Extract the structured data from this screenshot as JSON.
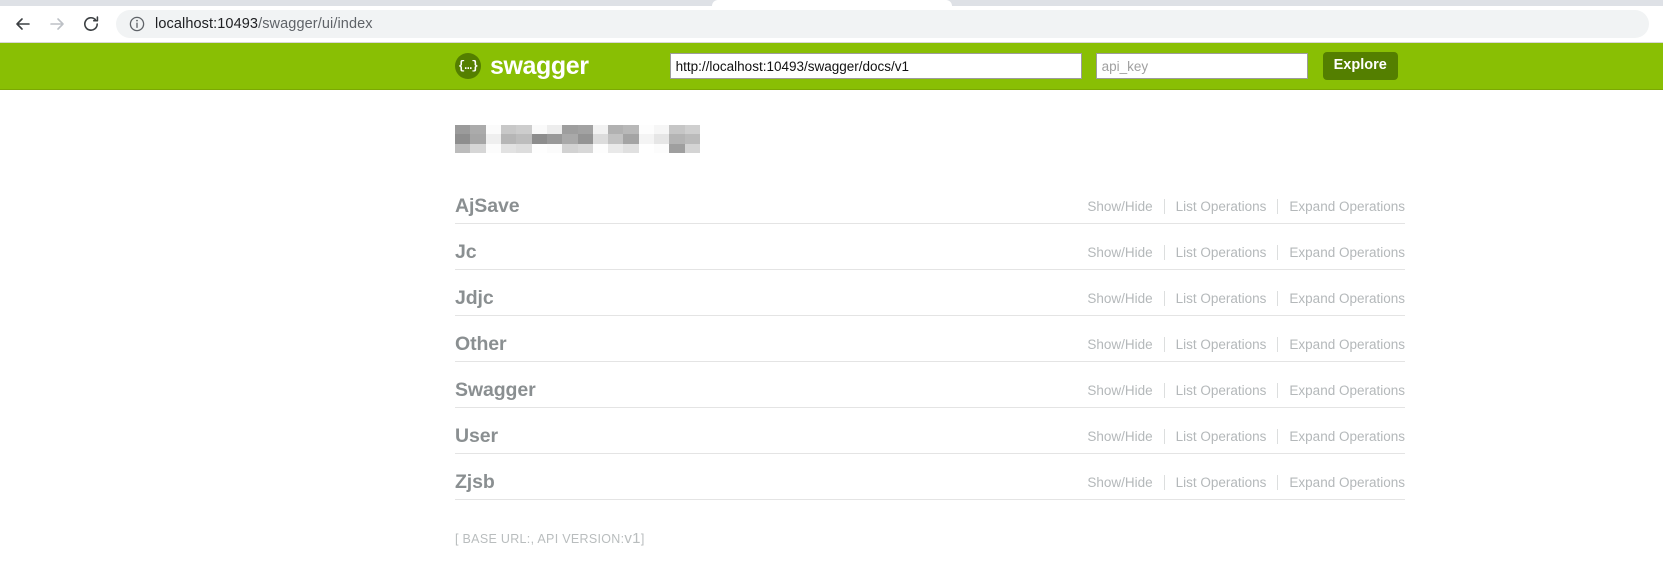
{
  "browser": {
    "back_icon": "arrow-left-icon",
    "forward_icon": "arrow-right-icon",
    "reload_icon": "reload-icon",
    "info_icon": "info-circle-icon",
    "url_host": "localhost:10493",
    "url_path": "/swagger/ui/index"
  },
  "header": {
    "logo_glyph": "{…}",
    "logo_text": "swagger",
    "spec_url_value": "http://localhost:10493/swagger/docs/v1",
    "api_key_placeholder": "api_key",
    "api_key_value": "",
    "explore_label": "Explore",
    "background_color": "#89bf04",
    "accent_dark": "#547f00"
  },
  "main": {
    "title_redacted": true,
    "resources": [
      {
        "name": "AjSave"
      },
      {
        "name": "Jc"
      },
      {
        "name": "Jdjc"
      },
      {
        "name": "Other"
      },
      {
        "name": "Swagger"
      },
      {
        "name": "User"
      },
      {
        "name": "Zjsb"
      }
    ],
    "operations": {
      "show_hide": "Show/Hide",
      "list_operations": "List Operations",
      "expand_operations": "Expand Operations"
    },
    "footer": {
      "prefix": "[ BASE URL:",
      "base_url": "",
      "version_label": ", API VERSION:",
      "version_value": "v1",
      "suffix": "]"
    }
  }
}
